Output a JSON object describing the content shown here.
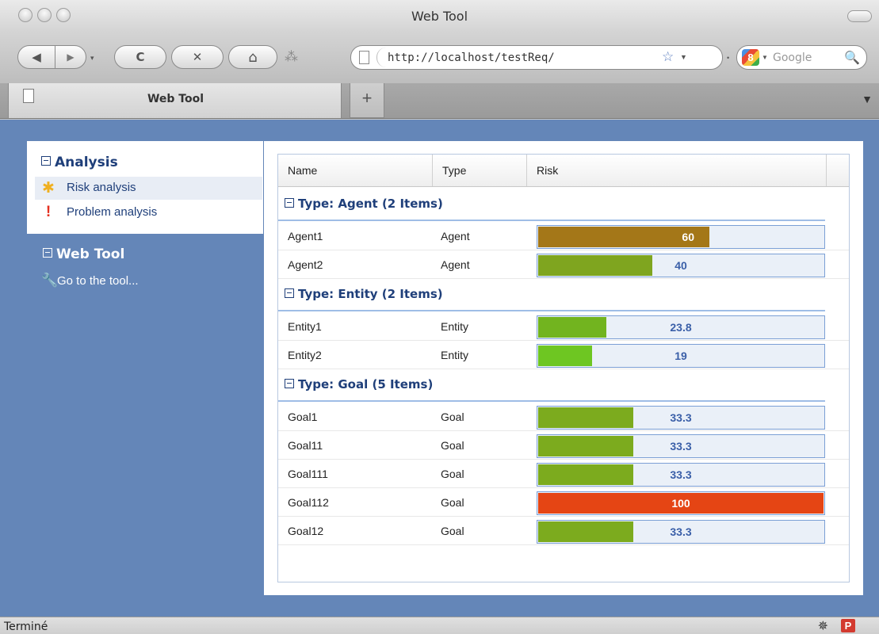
{
  "window": {
    "title": "Web Tool"
  },
  "toolbar": {
    "back_icon": "◀",
    "forward_icon": "▶",
    "reload_icon": "C",
    "stop_icon": "✕",
    "home_icon": "⌂",
    "addons_icon": "⁂",
    "url": "http://localhost/testReq/",
    "search_placeholder": "Google",
    "search_engine_letter": "8"
  },
  "tabs": {
    "active_label": "Web Tool",
    "new_tab_label": "+"
  },
  "nav": {
    "analysis_title": "Analysis",
    "items": [
      {
        "label": "Risk analysis",
        "icon": "asterisk-icon",
        "glyph": "✱"
      },
      {
        "label": "Problem analysis",
        "icon": "exclamation-icon",
        "glyph": "!"
      }
    ],
    "webtool_title": "Web Tool",
    "goto_label": "Go to the tool..."
  },
  "grid": {
    "columns": [
      "Name",
      "Type",
      "Risk"
    ],
    "groups": [
      {
        "title": "Type: Agent (2 Items)",
        "rows": [
          {
            "name": "Agent1",
            "type": "Agent",
            "risk": "60",
            "fraction": 0.6,
            "color": "#a47718",
            "label_on_fill": true
          },
          {
            "name": "Agent2",
            "type": "Agent",
            "risk": "40",
            "fraction": 0.4,
            "color": "#7fa51f",
            "label_on_fill": false
          }
        ]
      },
      {
        "title": "Type: Entity (2 Items)",
        "rows": [
          {
            "name": "Entity1",
            "type": "Entity",
            "risk": "23.8",
            "fraction": 0.238,
            "color": "#72b41f",
            "label_on_fill": false
          },
          {
            "name": "Entity2",
            "type": "Entity",
            "risk": "19",
            "fraction": 0.19,
            "color": "#6ec622",
            "label_on_fill": false
          }
        ]
      },
      {
        "title": "Type: Goal (5 Items)",
        "rows": [
          {
            "name": "Goal1",
            "type": "Goal",
            "risk": "33.3",
            "fraction": 0.333,
            "color": "#7cab1e",
            "label_on_fill": false
          },
          {
            "name": "Goal11",
            "type": "Goal",
            "risk": "33.3",
            "fraction": 0.333,
            "color": "#7cab1e",
            "label_on_fill": false
          },
          {
            "name": "Goal111",
            "type": "Goal",
            "risk": "33.3",
            "fraction": 0.333,
            "color": "#7cab1e",
            "label_on_fill": false
          },
          {
            "name": "Goal112",
            "type": "Goal",
            "risk": "100",
            "fraction": 1.0,
            "color": "#e54514",
            "label_on_fill": true
          },
          {
            "name": "Goal12",
            "type": "Goal",
            "risk": "33.3",
            "fraction": 0.333,
            "color": "#7cab1e",
            "label_on_fill": false
          }
        ]
      }
    ]
  },
  "status": {
    "text": "Terminé",
    "bug_icon": "✵",
    "p_label": "P"
  }
}
